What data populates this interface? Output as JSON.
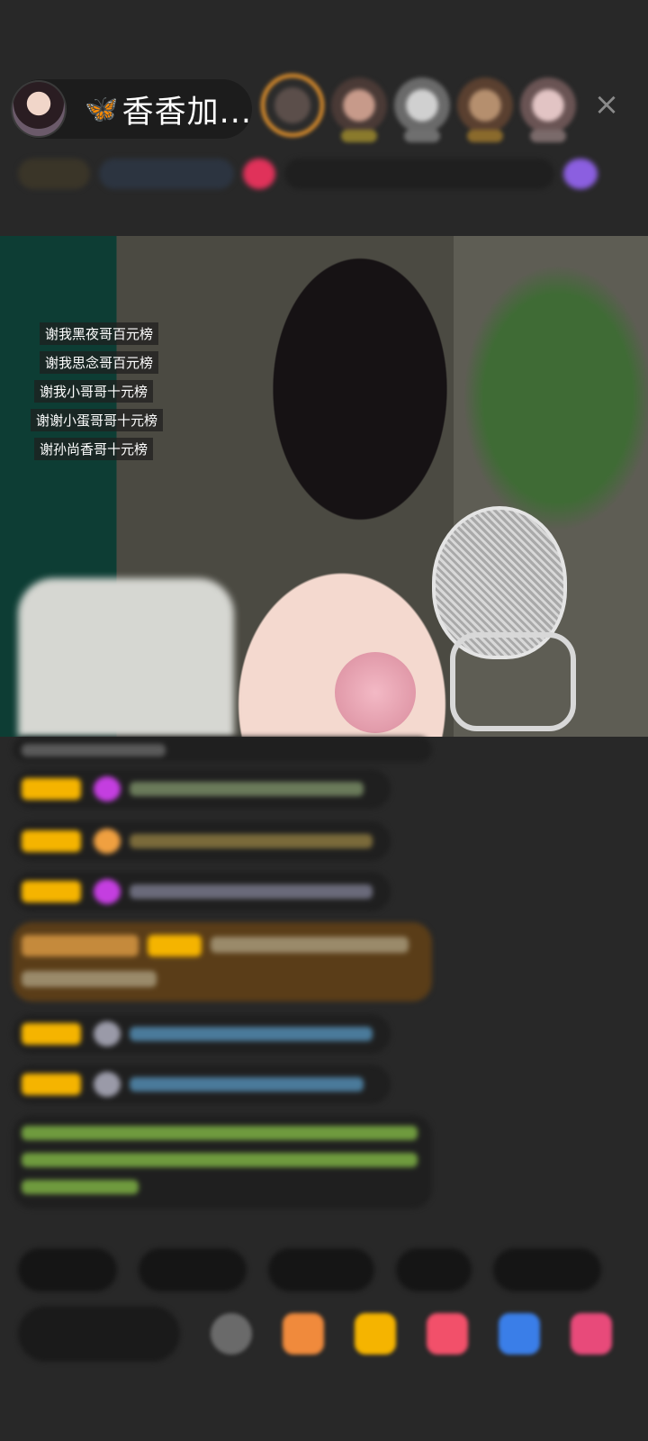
{
  "header": {
    "host_name": "香香加...",
    "butterfly_icon": "🦋",
    "close_icon": "×"
  },
  "video": {
    "thanks_tags": [
      "谢我黑夜哥百元榜",
      "谢我思念哥百元榜",
      "谢我小哥哥十元榜",
      "谢谢小蛋哥哥十元榜",
      "谢孙尚香哥十元榜"
    ]
  },
  "colors": {
    "background": "#282828",
    "pill": "#1c1c1c",
    "accent_orange": "#f39b2c",
    "badge_yellow": "#f5b400",
    "chat_green": "#8bc34a",
    "highlight_brown": "#5a3d18",
    "close_gray": "#8a8a8a"
  },
  "icons": [
    "butterfly-icon",
    "close-icon",
    "gift-icon",
    "emoji-icon",
    "red-packet-icon"
  ]
}
